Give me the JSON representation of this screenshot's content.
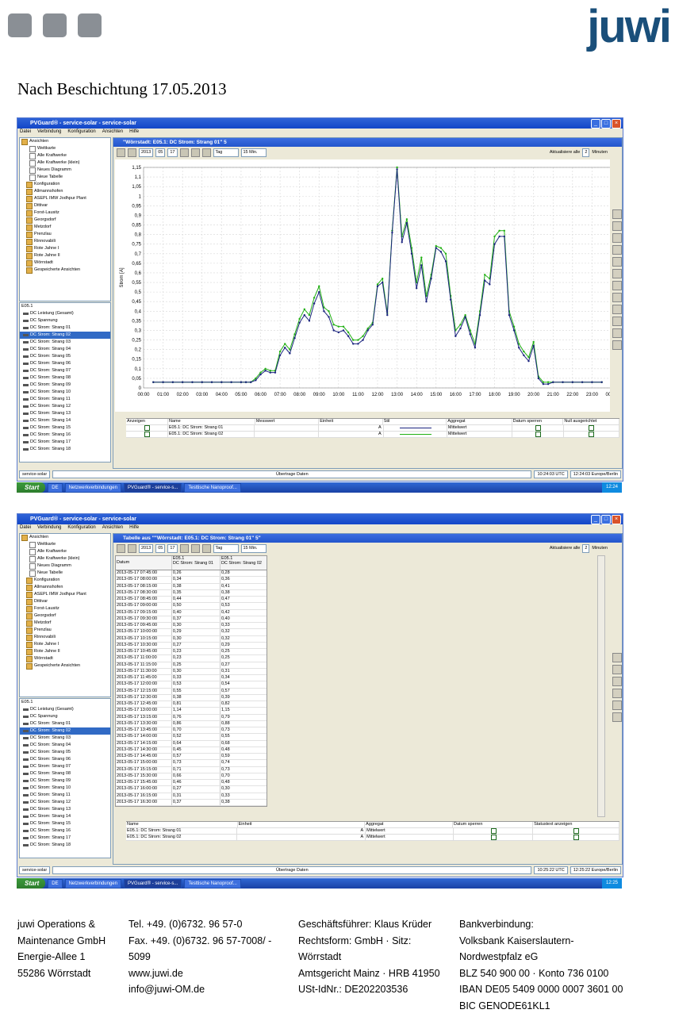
{
  "header": {
    "logo": "juwi",
    "title": "Nach Beschichtung 17.05.2013"
  },
  "colors": {
    "logo": "#1a4f7a",
    "series_blue": "#1a237e",
    "series_green": "#22b014",
    "titlebar": "#2f64d8"
  },
  "window1": {
    "title": "PVGuard® - service-solar - service-solar",
    "menu": [
      "Datei",
      "Verbindung",
      "Konfiguration",
      "Ansichten",
      "Hilfe"
    ],
    "inner_title": "\"Wörrstadt: E05.1: DC Strom: Strang 01\" 5",
    "date": {
      "year": "2013",
      "month": "05",
      "day": "17"
    },
    "period": "Tag",
    "interval": "15 Min.",
    "refresh_label": "Aktualisiere alle",
    "refresh_value": "2",
    "refresh_unit": "Minuten",
    "legend_headers": [
      "Anzeigen",
      "Name",
      "Messwert",
      "Einheit",
      "Stil",
      "Aggregat",
      "Datum sperren",
      "Null ausgerichtet"
    ],
    "legend_rows": [
      {
        "name": "E05.1: DC Strom: Strang 01",
        "unit": "A",
        "agg": "Mittelwert"
      },
      {
        "name": "E05.1: DC Strom: Strang 02",
        "unit": "A",
        "agg": "Mittelwert"
      }
    ],
    "status_server": "service-solar",
    "status_text": "Übertrage Daten",
    "time_utc": "10:24:03 UTC",
    "time_local": "12:24:03 Europe/Berlin"
  },
  "window2": {
    "title": "PVGuard® - service-solar - service-solar",
    "menu": [
      "Datei",
      "Verbindung",
      "Konfiguration",
      "Ansichten",
      "Hilfe"
    ],
    "inner_title": "Tabelle aus \"\"Wörrstadt: E05.1: DC Strom: Strang 01\" 5\"",
    "date": {
      "year": "2013",
      "month": "05",
      "day": "17"
    },
    "period": "Tag",
    "interval": "15 Min.",
    "refresh_label": "Aktualisiere alle",
    "refresh_value": "2",
    "refresh_unit": "Minuten",
    "table_headers": {
      "c1": "Datum",
      "c2a": "E05.1",
      "c2b": "DC Strom: Strang 01",
      "c3a": "E05.1",
      "c3b": "DC Strom: Strang 02"
    },
    "rows": [
      [
        "2013-05-17 07:45:00",
        "0,26",
        "0,28"
      ],
      [
        "2013-05-17 08:00:00",
        "0,34",
        "0,36"
      ],
      [
        "2013-05-17 08:15:00",
        "0,38",
        "0,41"
      ],
      [
        "2013-05-17 08:30:00",
        "0,35",
        "0,38"
      ],
      [
        "2013-05-17 08:45:00",
        "0,44",
        "0,47"
      ],
      [
        "2013-05-17 09:00:00",
        "0,50",
        "0,53"
      ],
      [
        "2013-05-17 09:15:00",
        "0,40",
        "0,42"
      ],
      [
        "2013-05-17 09:30:00",
        "0,37",
        "0,40"
      ],
      [
        "2013-05-17 09:45:00",
        "0,30",
        "0,33"
      ],
      [
        "2013-05-17 10:00:00",
        "0,29",
        "0,32"
      ],
      [
        "2013-05-17 10:15:00",
        "0,30",
        "0,32"
      ],
      [
        "2013-05-17 10:30:00",
        "0,27",
        "0,29"
      ],
      [
        "2013-05-17 10:45:00",
        "0,23",
        "0,25"
      ],
      [
        "2013-05-17 11:00:00",
        "0,23",
        "0,25"
      ],
      [
        "2013-05-17 11:15:00",
        "0,25",
        "0,27"
      ],
      [
        "2013-05-17 11:30:00",
        "0,30",
        "0,31"
      ],
      [
        "2013-05-17 11:45:00",
        "0,33",
        "0,34"
      ],
      [
        "2013-05-17 12:00:00",
        "0,53",
        "0,54"
      ],
      [
        "2013-05-17 12:15:00",
        "0,55",
        "0,57"
      ],
      [
        "2013-05-17 12:30:00",
        "0,38",
        "0,39"
      ],
      [
        "2013-05-17 12:45:00",
        "0,81",
        "0,82"
      ],
      [
        "2013-05-17 13:00:00",
        "1,14",
        "1,15"
      ],
      [
        "2013-05-17 13:15:00",
        "0,76",
        "0,79"
      ],
      [
        "2013-05-17 13:30:00",
        "0,86",
        "0,88"
      ],
      [
        "2013-05-17 13:45:00",
        "0,70",
        "0,73"
      ],
      [
        "2013-05-17 14:00:00",
        "0,52",
        "0,55"
      ],
      [
        "2013-05-17 14:15:00",
        "0,64",
        "0,68"
      ],
      [
        "2013-05-17 14:30:00",
        "0,45",
        "0,48"
      ],
      [
        "2013-05-17 14:45:00",
        "0,57",
        "0,59"
      ],
      [
        "2013-05-17 15:00:00",
        "0,73",
        "0,74"
      ],
      [
        "2013-05-17 15:15:00",
        "0,71",
        "0,73"
      ],
      [
        "2013-05-17 15:30:00",
        "0,66",
        "0,70"
      ],
      [
        "2013-05-17 15:45:00",
        "0,46",
        "0,48"
      ],
      [
        "2013-05-17 16:00:00",
        "0,27",
        "0,30"
      ],
      [
        "2013-05-17 16:15:00",
        "0,31",
        "0,33"
      ],
      [
        "2013-05-17 16:30:00",
        "0,37",
        "0,38"
      ]
    ],
    "legend_headers": [
      "Name",
      "Einheit",
      "Aggregat",
      "Datum sperren",
      "Statustext anzeigen"
    ],
    "legend_rows": [
      {
        "name": "E05.1: DC Strom: Strang 01",
        "unit": "A",
        "agg": "Mittelwert"
      },
      {
        "name": "E05.1: DC Strom: Strang 02",
        "unit": "A",
        "agg": "Mittelwert"
      }
    ],
    "status_server": "service-solar",
    "status_text": "Übertrage Daten",
    "time_utc": "10:25:22 UTC",
    "time_local": "12:25:22 Europe/Berlin"
  },
  "tree": [
    "Ansichten",
    "Weltkarte",
    "Alle Kraftwerke",
    "Alle Kraftwerke (klein)",
    "Neues Diagramm",
    "Neue Tabelle",
    "Konfiguration",
    "Allmannshofen",
    "ASEPL IMW Jodhpur Plant",
    "Dittivar",
    "Forst-Lausitz",
    "Georgsdorf",
    "Metzdorf",
    "Prenzlau",
    "Rinnovabili",
    "Rote Jahne I",
    "Rote Jahne II",
    "Wörrstadt",
    "Gespeicherte Ansichten"
  ],
  "series_list_header": "E05.1",
  "series_list": [
    "DC Leistung (Gesamt)",
    "DC Spannung",
    "DC Strom: Strang 01",
    "DC Strom: Strang 02",
    "DC Strom: Strang 03",
    "DC Strom: Strang 04",
    "DC Strom: Strang 05",
    "DC Strom: Strang 06",
    "DC Strom: Strang 07",
    "DC Strom: Strang 08",
    "DC Strom: Strang 09",
    "DC Strom: Strang 10",
    "DC Strom: Strang 11",
    "DC Strom: Strang 12",
    "DC Strom: Strang 13",
    "DC Strom: Strang 14",
    "DC Strom: Strang 15",
    "DC Strom: Strang 16",
    "DC Strom: Strang 17",
    "DC Strom: Strang 18"
  ],
  "taskbar1": {
    "start": "Start",
    "lang": "DE",
    "tasks": [
      "Netzwerkverbindungen",
      "PVGuard® - service-s...",
      "Testtische Nanoproof..."
    ],
    "clock": "12:24"
  },
  "taskbar2": {
    "start": "Start",
    "lang": "DE",
    "tasks": [
      "Netzwerkverbindungen",
      "PVGuard® - service-s...",
      "Testtische Nanoproof..."
    ],
    "clock": "12:25"
  },
  "footer": {
    "col1": [
      "juwi Operations &",
      "Maintenance GmbH",
      "Energie-Allee 1",
      "55286 Wörrstadt"
    ],
    "col2": [
      "Tel. +49. (0)6732. 96 57-0",
      "Fax. +49. (0)6732. 96 57-7008/ -",
      "5099",
      "www.juwi.de",
      "info@juwi-OM.de"
    ],
    "col3": [
      "Geschäftsführer: Klaus Krüder",
      "Rechtsform: GmbH · Sitz:",
      "Wörrstadt",
      "Amtsgericht Mainz · HRB 41950",
      "USt-IdNr.: DE202203536"
    ],
    "col4": [
      "Bankverbindung:",
      "Volksbank Kaiserslautern-",
      "Nordwestpfalz eG",
      "BLZ 540 900 00 · Konto 736 0100",
      "IBAN DE05 5409 0000 0007 3601 00",
      "BIC GENODE61KL1"
    ]
  },
  "chart_data": {
    "type": "line",
    "ylabel": "Strom [A]",
    "ylim": [
      0,
      1.15
    ],
    "yticks": [
      "0",
      "0,05",
      "0,1",
      "0,15",
      "0,2",
      "0,25",
      "0,3",
      "0,35",
      "0,4",
      "0,45",
      "0,5",
      "0,55",
      "0,6",
      "0,65",
      "0,7",
      "0,75",
      "0,8",
      "0,85",
      "0,9",
      "0,95",
      "1",
      "1,05",
      "1,1",
      "1,15"
    ],
    "xticks": [
      "00:00",
      "01:00",
      "02:00",
      "03:00",
      "04:00",
      "05:00",
      "06:00",
      "07:00",
      "08:00",
      "09:00",
      "10:00",
      "11:00",
      "12:00",
      "13:00",
      "14:00",
      "15:00",
      "16:00",
      "17:00",
      "18:00",
      "19:00",
      "20:00",
      "21:00",
      "22:00",
      "23:00",
      "00:00"
    ],
    "x_hours": [
      0.5,
      1,
      1.5,
      2,
      2.5,
      3,
      3.5,
      4,
      4.5,
      5,
      5.25,
      5.5,
      5.75,
      6,
      6.25,
      6.5,
      6.75,
      7,
      7.25,
      7.5,
      7.75,
      8,
      8.25,
      8.5,
      8.75,
      9,
      9.25,
      9.5,
      9.75,
      10,
      10.25,
      10.5,
      10.75,
      11,
      11.25,
      11.5,
      11.75,
      12,
      12.25,
      12.5,
      12.75,
      13,
      13.25,
      13.5,
      13.75,
      14,
      14.25,
      14.5,
      14.75,
      15,
      15.25,
      15.5,
      15.75,
      16,
      16.25,
      16.5,
      16.75,
      17,
      17.25,
      17.5,
      17.75,
      18,
      18.25,
      18.5,
      18.75,
      19,
      19.25,
      19.5,
      19.75,
      20,
      20.25,
      20.5,
      20.75,
      21,
      21.5,
      22,
      22.5,
      23,
      23.5
    ],
    "series": [
      {
        "name": "E05.1: DC Strom: Strang 01",
        "color": "#1a237e",
        "values": [
          0.03,
          0.03,
          0.03,
          0.03,
          0.03,
          0.03,
          0.03,
          0.03,
          0.03,
          0.03,
          0.03,
          0.03,
          0.04,
          0.07,
          0.09,
          0.08,
          0.08,
          0.17,
          0.21,
          0.18,
          0.26,
          0.34,
          0.38,
          0.35,
          0.44,
          0.5,
          0.4,
          0.37,
          0.3,
          0.29,
          0.3,
          0.27,
          0.23,
          0.23,
          0.25,
          0.3,
          0.33,
          0.53,
          0.55,
          0.38,
          0.81,
          1.14,
          0.76,
          0.86,
          0.7,
          0.52,
          0.64,
          0.45,
          0.57,
          0.73,
          0.71,
          0.66,
          0.46,
          0.27,
          0.31,
          0.37,
          0.28,
          0.21,
          0.38,
          0.56,
          0.54,
          0.75,
          0.79,
          0.79,
          0.38,
          0.3,
          0.21,
          0.17,
          0.14,
          0.22,
          0.05,
          0.02,
          0.02,
          0.03,
          0.03,
          0.03,
          0.03,
          0.03,
          0.03
        ]
      },
      {
        "name": "E05.1: DC Strom: Strang 02",
        "color": "#22b014",
        "values": [
          0.03,
          0.03,
          0.03,
          0.03,
          0.03,
          0.03,
          0.03,
          0.03,
          0.03,
          0.03,
          0.03,
          0.03,
          0.05,
          0.08,
          0.1,
          0.09,
          0.09,
          0.19,
          0.23,
          0.2,
          0.28,
          0.36,
          0.41,
          0.38,
          0.47,
          0.53,
          0.42,
          0.4,
          0.33,
          0.32,
          0.32,
          0.29,
          0.25,
          0.25,
          0.27,
          0.31,
          0.34,
          0.54,
          0.57,
          0.39,
          0.82,
          1.15,
          0.79,
          0.88,
          0.73,
          0.55,
          0.68,
          0.48,
          0.59,
          0.74,
          0.73,
          0.7,
          0.48,
          0.3,
          0.33,
          0.38,
          0.3,
          0.23,
          0.4,
          0.59,
          0.57,
          0.79,
          0.82,
          0.82,
          0.4,
          0.32,
          0.23,
          0.19,
          0.16,
          0.24,
          0.06,
          0.03,
          0.03,
          0.03,
          0.03,
          0.03,
          0.03,
          0.03,
          0.03
        ]
      }
    ]
  }
}
